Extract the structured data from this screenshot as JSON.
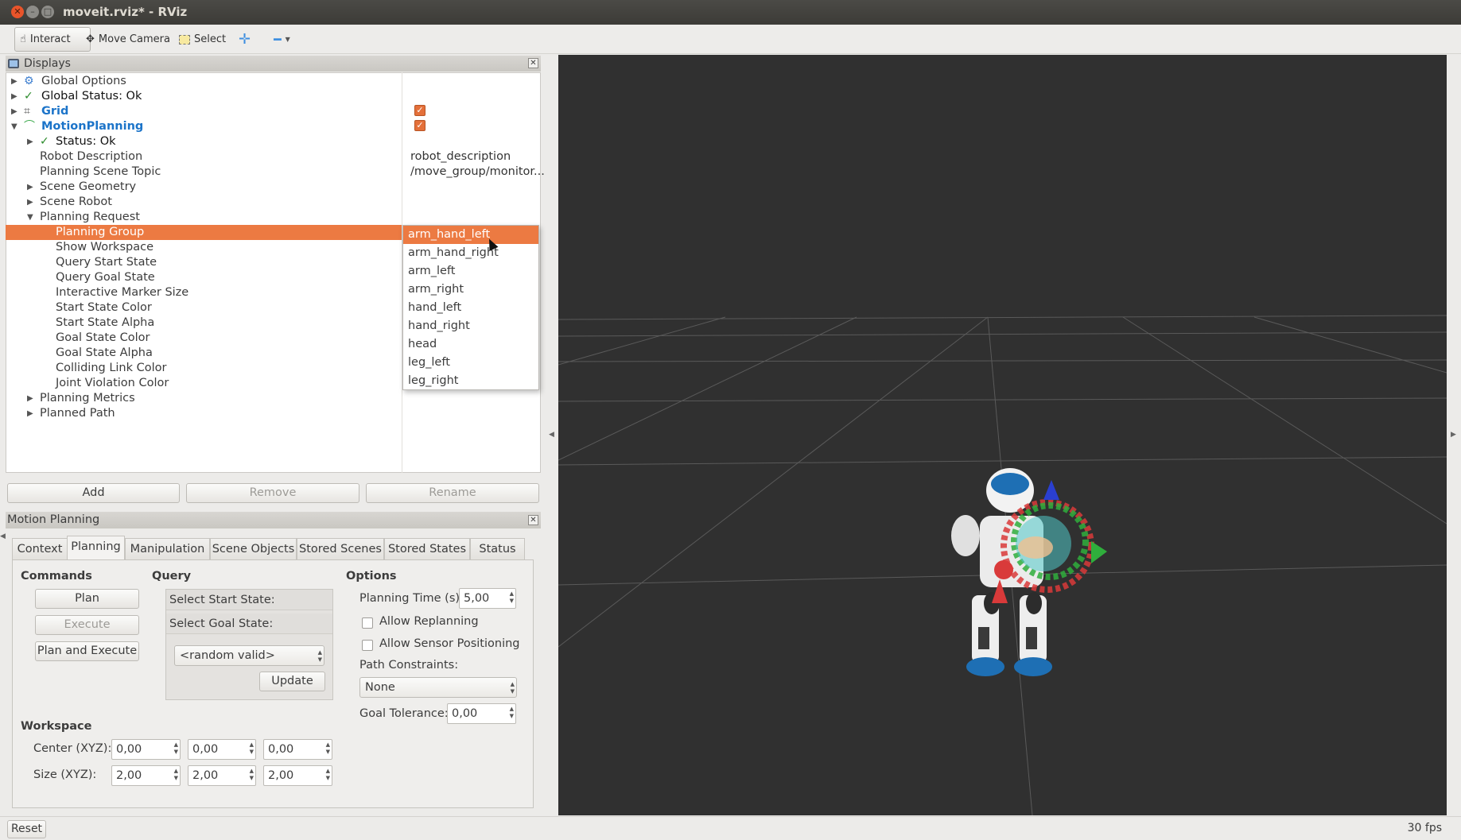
{
  "window": {
    "title": "moveit.rviz* - RViz"
  },
  "toolbar": {
    "interact": "Interact",
    "move_camera": "Move Camera",
    "select": "Select"
  },
  "displays": {
    "title": "Displays",
    "tree": {
      "global_options": "Global Options",
      "global_status": "Global Status: Ok",
      "grid": "Grid",
      "motion_planning": "MotionPlanning",
      "status_ok": "Status: Ok",
      "robot_description": "Robot Description",
      "planning_scene_topic": "Planning Scene Topic",
      "scene_geometry": "Scene Geometry",
      "scene_robot": "Scene Robot",
      "planning_request": "Planning Request",
      "planning_group": "Planning Group",
      "show_workspace": "Show Workspace",
      "query_start_state": "Query Start State",
      "query_goal_state": "Query Goal State",
      "interactive_marker_size": "Interactive Marker Size",
      "start_state_color": "Start State Color",
      "start_state_alpha": "Start State Alpha",
      "goal_state_color": "Goal State Color",
      "goal_state_alpha": "Goal State Alpha",
      "colliding_link_color": "Colliding Link Color",
      "joint_violation_color": "Joint Violation Color",
      "planning_metrics": "Planning Metrics",
      "planned_path": "Planned Path"
    },
    "values": {
      "robot_description": "robot_description",
      "planning_scene_topic": "/move_group/monitor..."
    },
    "dropdown_options": [
      "arm_hand_left",
      "arm_hand_right",
      "arm_left",
      "arm_right",
      "hand_left",
      "hand_right",
      "head",
      "leg_left",
      "leg_right"
    ],
    "buttons": {
      "add": "Add",
      "remove": "Remove",
      "rename": "Rename"
    }
  },
  "motion_planning": {
    "title": "Motion Planning",
    "tabs": [
      "Context",
      "Planning",
      "Manipulation",
      "Scene Objects",
      "Stored Scenes",
      "Stored States",
      "Status"
    ],
    "commands": {
      "heading": "Commands",
      "plan": "Plan",
      "execute": "Execute",
      "plan_and_execute": "Plan and Execute"
    },
    "query": {
      "heading": "Query",
      "select_start": "Select Start State:",
      "select_goal": "Select Goal State:",
      "goal_combo": "<random valid>",
      "update": "Update"
    },
    "options": {
      "heading": "Options",
      "planning_time_label": "Planning Time (s):",
      "planning_time_value": "5,00",
      "allow_replanning": "Allow Replanning",
      "allow_sensor_positioning": "Allow Sensor Positioning",
      "path_constraints_label": "Path Constraints:",
      "path_constraints_value": "None",
      "goal_tolerance_label": "Goal Tolerance:",
      "goal_tolerance_value": "0,00"
    },
    "workspace": {
      "heading": "Workspace",
      "center_label": "Center (XYZ):",
      "center": [
        "0,00",
        "0,00",
        "0,00"
      ],
      "size_label": "Size (XYZ):",
      "size": [
        "2,00",
        "2,00",
        "2,00"
      ]
    }
  },
  "statusbar": {
    "reset": "Reset",
    "fps": "30 fps"
  },
  "colors": {
    "accent": "#ec7a42",
    "viewport_bg": "#303030",
    "link_blue": "#1c74c9"
  }
}
